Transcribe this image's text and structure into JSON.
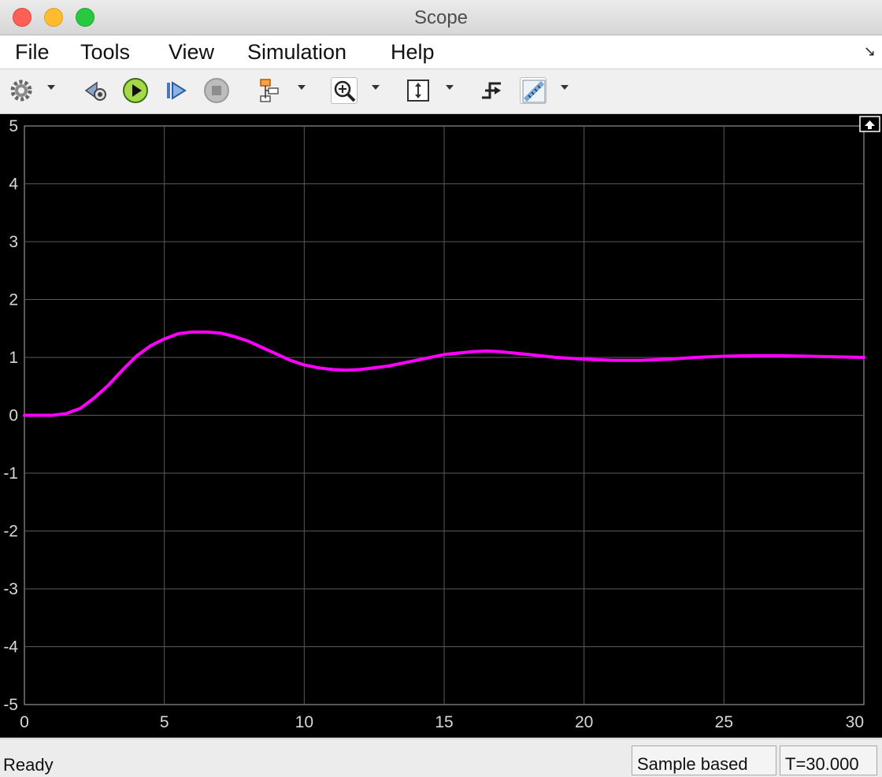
{
  "window": {
    "title": "Scope"
  },
  "menu": {
    "items": [
      "File",
      "Tools",
      "View",
      "Simulation",
      "Help"
    ]
  },
  "toolbar": {
    "icons": [
      "gear-icon",
      "step-back-icon",
      "run-icon",
      "step-forward-icon",
      "stop-icon",
      "highlight-block-icon",
      "zoom-icon",
      "scale-axes-icon",
      "triggers-icon",
      "measurements-icon"
    ]
  },
  "chart_data": {
    "type": "line",
    "xlim": [
      0,
      30
    ],
    "ylim": [
      -5,
      5
    ],
    "xticks": [
      "0",
      "5",
      "10",
      "15",
      "20",
      "25",
      "30"
    ],
    "yticks": [
      "5",
      "4",
      "3",
      "2",
      "1",
      "0",
      "-1",
      "-2",
      "-3",
      "-4",
      "-5"
    ],
    "grid": true,
    "background": "#000000",
    "gridColor": "#5a5a5a",
    "series": [
      {
        "color": "#ff00ff",
        "x": [
          0,
          1,
          1.5,
          2,
          2.5,
          3,
          3.5,
          4,
          4.5,
          5,
          5.5,
          6,
          6.5,
          7,
          7.5,
          8,
          8.5,
          9,
          9.5,
          10,
          10.5,
          11,
          11.5,
          12,
          13,
          14,
          15,
          16,
          16.5,
          17,
          18,
          19,
          20,
          21,
          22,
          23,
          24,
          25,
          26,
          27,
          28,
          29,
          30
        ],
        "y": [
          0,
          0,
          0.03,
          0.12,
          0.3,
          0.52,
          0.78,
          1.02,
          1.2,
          1.32,
          1.41,
          1.44,
          1.44,
          1.42,
          1.36,
          1.28,
          1.17,
          1.06,
          0.95,
          0.87,
          0.82,
          0.79,
          0.78,
          0.79,
          0.85,
          0.95,
          1.05,
          1.1,
          1.11,
          1.1,
          1.05,
          1.0,
          0.97,
          0.95,
          0.95,
          0.97,
          1.0,
          1.02,
          1.03,
          1.03,
          1.02,
          1.01,
          1.0
        ]
      }
    ]
  },
  "status": {
    "left": "Ready",
    "mode": "Sample based",
    "time": "T=30.000"
  }
}
